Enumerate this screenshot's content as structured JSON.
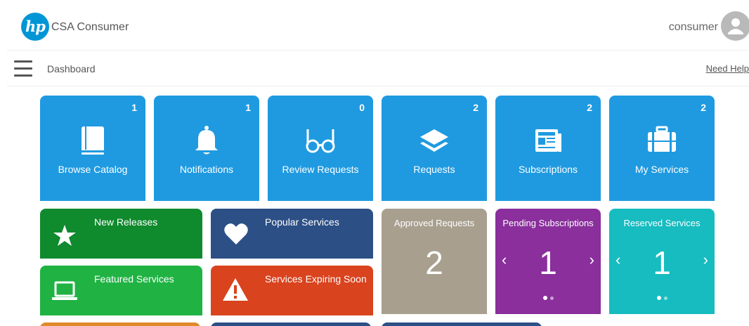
{
  "header": {
    "logo_text": "hp",
    "app_title": "CSA Consumer",
    "user_name": "consumer"
  },
  "nav": {
    "breadcrumb": "Dashboard",
    "help_link": "Need Help"
  },
  "tiles": [
    {
      "label": "Browse Catalog",
      "count": "1",
      "icon": "book-icon",
      "color": "#1f9ae0"
    },
    {
      "label": "Notifications",
      "count": "1",
      "icon": "bell-icon",
      "color": "#1f9ae0"
    },
    {
      "label": "Review Requests",
      "count": "0",
      "icon": "glasses-icon",
      "color": "#1f9ae0"
    },
    {
      "label": "Requests",
      "count": "2",
      "icon": "layers-icon",
      "color": "#1f9ae0"
    },
    {
      "label": "Subscriptions",
      "count": "2",
      "icon": "newspaper-icon",
      "color": "#1f9ae0"
    },
    {
      "label": "My Services",
      "count": "2",
      "icon": "briefcase-icon",
      "color": "#1f9ae0"
    }
  ],
  "small_tiles": [
    {
      "label": "New Releases",
      "icon": "star-icon",
      "color": "#0f8a2d"
    },
    {
      "label": "Popular Services",
      "icon": "heart-icon",
      "color": "#2c4f85"
    },
    {
      "label": "Featured Services",
      "icon": "laptop-icon",
      "color": "#20b344"
    },
    {
      "label": "Services Expiring Soon",
      "icon": "warning-icon",
      "color": "#d9431e"
    }
  ],
  "count_tiles": [
    {
      "label": "Approved Requests",
      "value": "2",
      "color": "#a89f8f"
    },
    {
      "label": "Pending  Subscriptions",
      "value": "1",
      "color": "#8a2f9c"
    },
    {
      "label": "Reserved Services",
      "value": "1",
      "color": "#16bcc0"
    }
  ],
  "carousel": {
    "prev_glyph": "‹",
    "next_glyph": "›",
    "pages": 2,
    "active_page": 1
  }
}
